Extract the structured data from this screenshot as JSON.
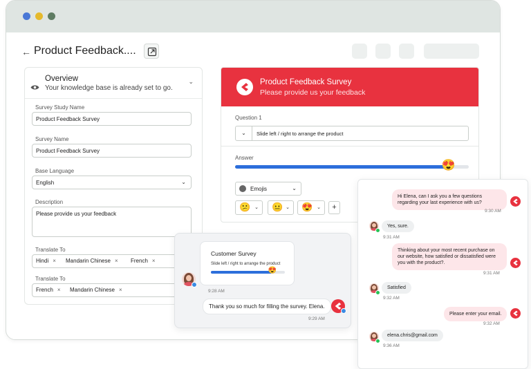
{
  "window": {
    "title": "Product Feedback...."
  },
  "overview": {
    "title": "Overview",
    "subtitle": "Your knowledge base is already set to go."
  },
  "form": {
    "survey_study_name_label": "Survey Study Name",
    "survey_study_name_value": "Product Feedback Survey",
    "survey_name_label": "Survey Name",
    "survey_name_value": "Product Feedback Survey",
    "base_language_label": "Base Language",
    "base_language_value": "English",
    "description_label": "Description",
    "description_value": "Please provide us your feedback",
    "translate_to_label_1": "Translate To",
    "translate_to_tags_1": [
      "Hindi",
      "Mandarin Chinese",
      "French"
    ],
    "translate_to_label_2": "Translate To",
    "translate_to_tags_2": [
      "French",
      "Mandarin Chinese"
    ]
  },
  "survey": {
    "title": "Product Feedback Survey",
    "subtitle": "Please provide us your feedback",
    "question_label": "Question 1",
    "question_text": "Slide left / right to arrange the product",
    "answer_label": "Answer",
    "slider_value": 0.91,
    "slider_emoji": "😍",
    "emoji_select_label": "Emojis",
    "emoji_options": [
      "😕",
      "😐",
      "😍"
    ],
    "add_label": "+"
  },
  "mini_chat": {
    "card_title": "Customer Survey",
    "card_subtitle": "Slide left / right to arrange the product",
    "card_slider_value": 0.82,
    "card_slider_emoji": "😍",
    "card_time": "9:28 AM",
    "reply_text": "Thank you so much for filling the survey. Elena.",
    "reply_time": "9:29 AM"
  },
  "chat": {
    "messages": [
      {
        "from": "agent",
        "text": "Hi Elena, can I ask you a few questions regarding your last experience with us?",
        "time": "9:30 AM"
      },
      {
        "from": "user",
        "text": "Yes, sure.",
        "time": "9:31 AM"
      },
      {
        "from": "agent",
        "text": "Thinking about your most recent purchase on our website, how satisfied or dissatisfied were you with the product?.",
        "time": "9:31 AM"
      },
      {
        "from": "user",
        "text": "Satisfied",
        "time": "9:32 AM"
      },
      {
        "from": "agent",
        "text": "Please enter your email.",
        "time": "9:32 AM"
      },
      {
        "from": "user",
        "text": "elena.chris@gmail.com",
        "time": "9:36 AM"
      }
    ]
  },
  "colors": {
    "brand_red": "#e8323f",
    "slider_blue": "#2c6edb",
    "agent_bubble": "#fde6e9"
  }
}
